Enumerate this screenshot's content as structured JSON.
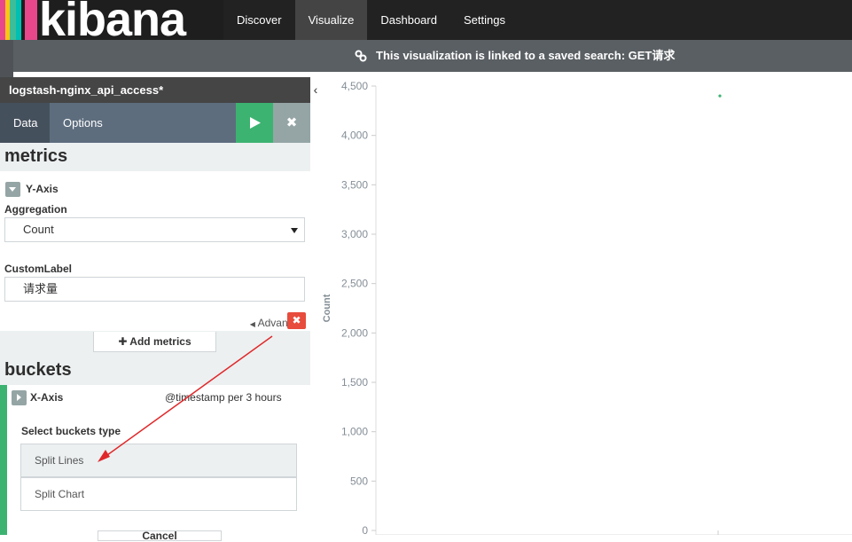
{
  "brand": {
    "logo_text": "kibana",
    "stripe_colors": [
      "#e8478b",
      "#3fbd98",
      "#fec514",
      "#00bfb3",
      "#e8478b"
    ]
  },
  "topnav": {
    "items": [
      {
        "label": "Discover",
        "active": false
      },
      {
        "label": "Visualize",
        "active": true
      },
      {
        "label": "Dashboard",
        "active": false
      },
      {
        "label": "Settings",
        "active": false
      }
    ]
  },
  "banner": {
    "icon": "link-icon",
    "text": "This visualization is linked to a saved search: GET请求"
  },
  "editor": {
    "title": "logstash-nginx_api_access*",
    "collapse_glyph": "‹",
    "tabs": [
      {
        "label": "Data",
        "active": true
      },
      {
        "label": "Options",
        "active": false
      }
    ],
    "apply_icon": "play-icon",
    "discard_icon": "close-icon",
    "discard_glyph": "✖",
    "metrics_heading": "metrics",
    "y_axis_label": "Y-Axis",
    "aggregation_label": "Aggregation",
    "aggregation_value": "Count",
    "custom_label_label": "CustomLabel",
    "custom_label_value": "请求量",
    "advanced_label": "Advanced",
    "add_metrics_label": "Add metrics",
    "buckets_heading": "buckets",
    "x_axis_label": "X-Axis",
    "x_axis_summary": "@timestamp per 3 hours",
    "remove_glyph": "✖",
    "select_bucket_type_label": "Select buckets type",
    "bucket_types": [
      "Split Lines",
      "Split Chart"
    ],
    "cancel_label": "Cancel"
  },
  "colors": {
    "apply": "#3cb371",
    "remove": "#e74c3c",
    "point": "#3cb371",
    "arrow": "#e0282a"
  },
  "chart_data": {
    "type": "line",
    "ylabel": "Count",
    "ylim": [
      0,
      4500
    ],
    "y_ticks": [
      "0",
      "500",
      "1,000",
      "1,500",
      "2,000",
      "2,500",
      "3,000",
      "3,500",
      "4,000",
      "4,500"
    ],
    "series": [
      {
        "values": [
          4400
        ]
      }
    ]
  }
}
